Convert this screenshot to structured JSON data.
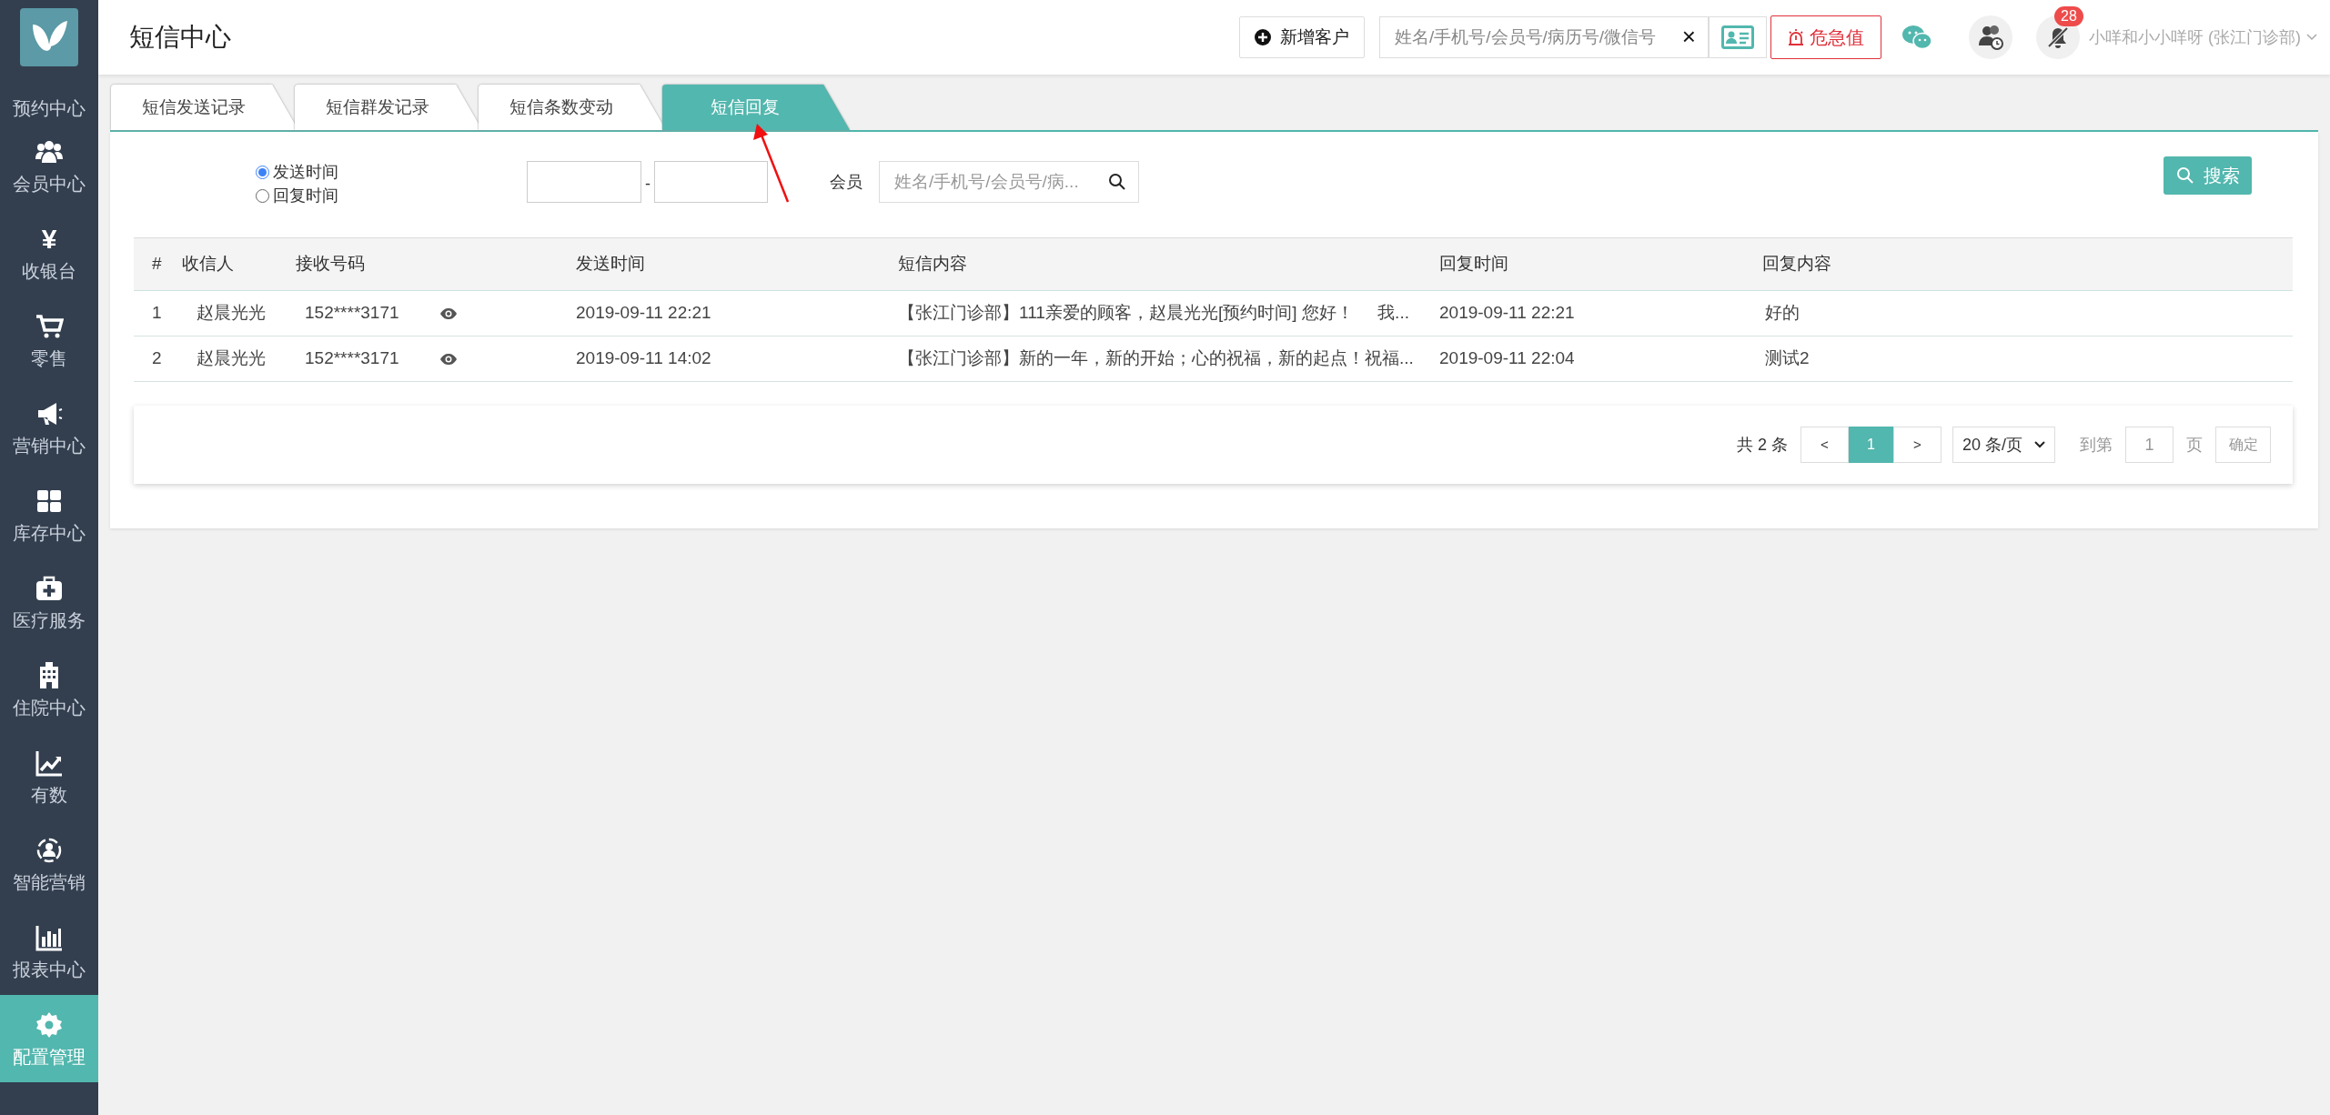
{
  "header": {
    "title": "短信中心",
    "add_button": "新增客户",
    "search": {
      "placeholder": "姓名/手机号/会员号/病历号/微信号",
      "clear": "×"
    },
    "alert_button": "危急值",
    "notification_badge": "28",
    "user": "小咩和小小咩呀 (张江门诊部)"
  },
  "sidebar": {
    "items": [
      {
        "label": "预约中心",
        "selected": false
      },
      {
        "label": "会员中心",
        "selected": false
      },
      {
        "label": "收银台",
        "glyph": "¥",
        "selected": false
      },
      {
        "label": "零售",
        "selected": false
      },
      {
        "label": "营销中心",
        "selected": false
      },
      {
        "label": "库存中心",
        "selected": false
      },
      {
        "label": "医疗服务",
        "selected": false
      },
      {
        "label": "住院中心",
        "selected": false
      },
      {
        "label": "有数",
        "selected": false
      },
      {
        "label": "智能营销",
        "selected": false
      },
      {
        "label": "报表中心",
        "selected": false
      },
      {
        "label": "配置管理",
        "selected": true
      }
    ]
  },
  "tabs": [
    {
      "label": "短信发送记录",
      "selected": false
    },
    {
      "label": "短信群发记录",
      "selected": false
    },
    {
      "label": "短信条数变动",
      "selected": false
    },
    {
      "label": "短信回复",
      "selected": true
    }
  ],
  "filter": {
    "time_options": [
      {
        "label": "发送时间",
        "selected": true
      },
      {
        "label": "回复时间",
        "selected": false
      }
    ],
    "date_separator": "-",
    "member_label": "会员",
    "member_search": {
      "placeholder": "姓名/手机号/会员号/病..."
    },
    "search_button": "搜索"
  },
  "table": {
    "columns": [
      "#",
      "收信人",
      "接收号码",
      "发送时间",
      "短信内容",
      "回复时间",
      "回复内容"
    ],
    "rows": [
      {
        "index": "1",
        "recipient": "赵晨光光",
        "phone": "152****3171",
        "send_time": "2019-09-11 22:21",
        "content": "【张江门诊部】111亲爱的顾客，赵晨光光[预约时间] 您好！     我...",
        "reply_time": "2019-09-11 22:21",
        "reply": "好的"
      },
      {
        "index": "2",
        "recipient": "赵晨光光",
        "phone": "152****3171",
        "send_time": "2019-09-11 14:02",
        "content": "【张江门诊部】新的一年，新的开始；心的祝福，新的起点！祝福...",
        "reply_time": "2019-09-11 22:04",
        "reply": "测试2"
      }
    ]
  },
  "pagination": {
    "total": "共 2 条",
    "prev": "<",
    "pages": [
      {
        "label": "1",
        "selected": true
      }
    ],
    "next": ">",
    "page_size": "20 条/页",
    "goto_label": "到第",
    "goto_value": "1",
    "page_unit": "页",
    "confirm": "确定"
  }
}
